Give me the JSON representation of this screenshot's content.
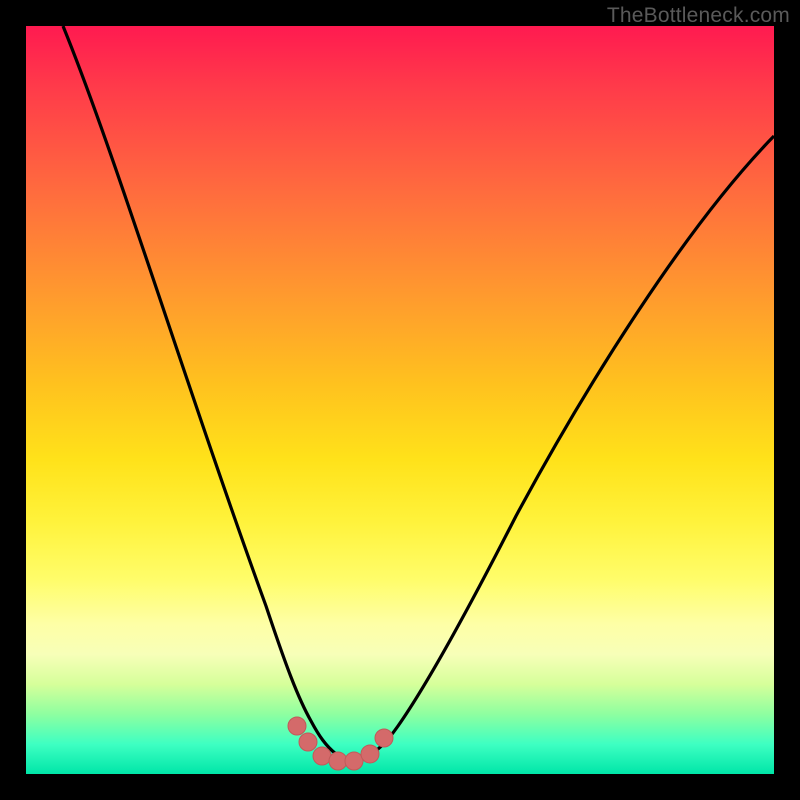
{
  "watermark": "TheBottleneck.com",
  "colors": {
    "curve": "#000000",
    "marker_fill": "#d46a6a",
    "marker_stroke": "#b85050",
    "gradient_top": "#ff1a50",
    "gradient_bottom": "#00e6a8",
    "frame": "#000000"
  },
  "chart_data": {
    "type": "line",
    "title": "",
    "xlabel": "",
    "ylabel": "",
    "xlim": [
      0,
      100
    ],
    "ylim": [
      0,
      100
    ],
    "grid": false,
    "series": [
      {
        "name": "bottleneck-curve",
        "x": [
          5,
          10,
          15,
          20,
          25,
          30,
          34,
          36,
          38,
          40,
          42,
          44,
          46,
          50,
          55,
          60,
          65,
          70,
          75,
          80,
          85,
          90,
          95,
          100
        ],
        "y": [
          100,
          86,
          72,
          58,
          44,
          30,
          16,
          10,
          5,
          2,
          1,
          1,
          2,
          6,
          14,
          23,
          32,
          41,
          49,
          56,
          62,
          67,
          71,
          74
        ]
      }
    ],
    "markers": [
      {
        "x": 36,
        "y": 6
      },
      {
        "x": 38,
        "y": 3
      },
      {
        "x": 40,
        "y": 1.5
      },
      {
        "x": 42,
        "y": 1
      },
      {
        "x": 44,
        "y": 1
      },
      {
        "x": 46,
        "y": 2
      },
      {
        "x": 48,
        "y": 4
      }
    ]
  }
}
